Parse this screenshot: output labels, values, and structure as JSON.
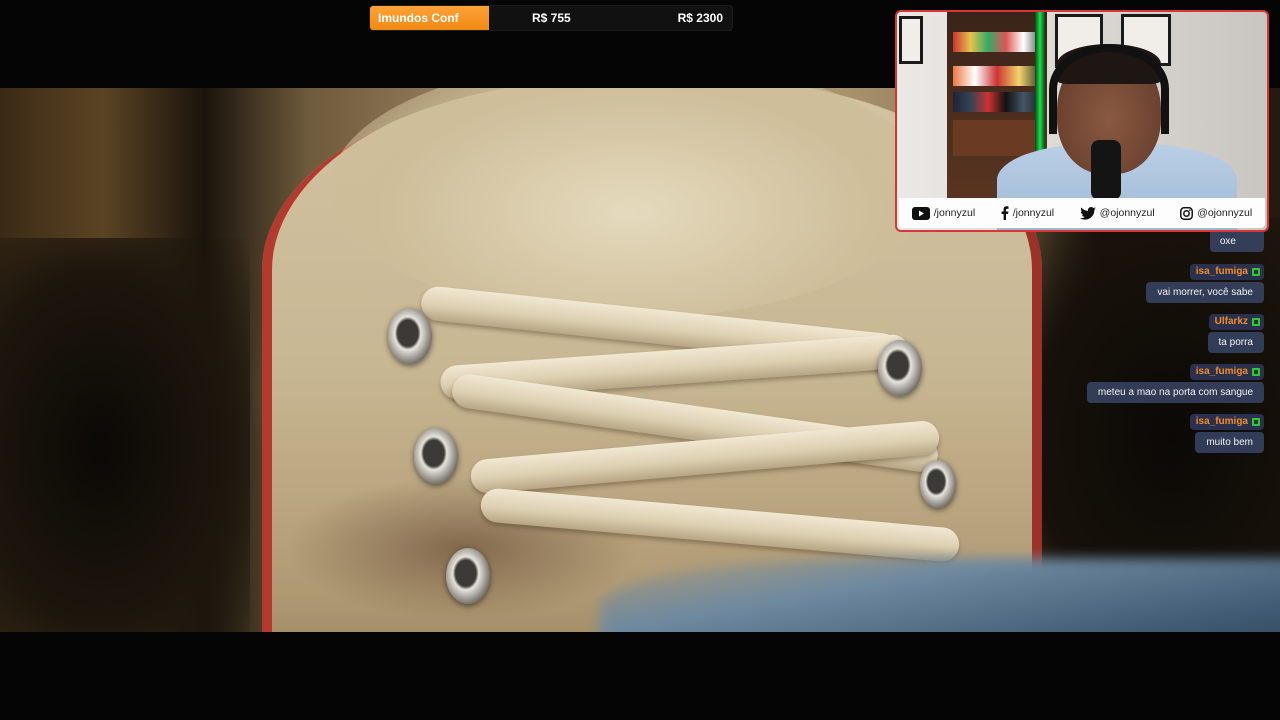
{
  "goal": {
    "name": "Imundos Conf",
    "current": "R$ 755",
    "target": "R$ 2300",
    "progress": 0.328,
    "fill_color": "#f59a20"
  },
  "webcam": {
    "border_color": "#d8343a",
    "socials": [
      {
        "icon": "youtube-icon",
        "handle": "/jonnyzul"
      },
      {
        "icon": "facebook-icon",
        "handle": "/jonnyzul"
      },
      {
        "icon": "twitter-icon",
        "handle": "@ojonnyzul"
      },
      {
        "icon": "instagram-icon",
        "handle": "@ojonnyzul"
      }
    ]
  },
  "chat": {
    "partial_message": "oxe",
    "messages": [
      {
        "user": "isa_fumiga",
        "text": "vai morrer, você sabe"
      },
      {
        "user": "Ulfarkz",
        "text": "ta porra"
      },
      {
        "user": "isa_fumiga",
        "text": "meteu a mao na porta com sangue"
      },
      {
        "user": "isa_fumiga",
        "text": "muito bem"
      }
    ],
    "username_color": "#f28c28",
    "badge_color": "#35c43f"
  }
}
